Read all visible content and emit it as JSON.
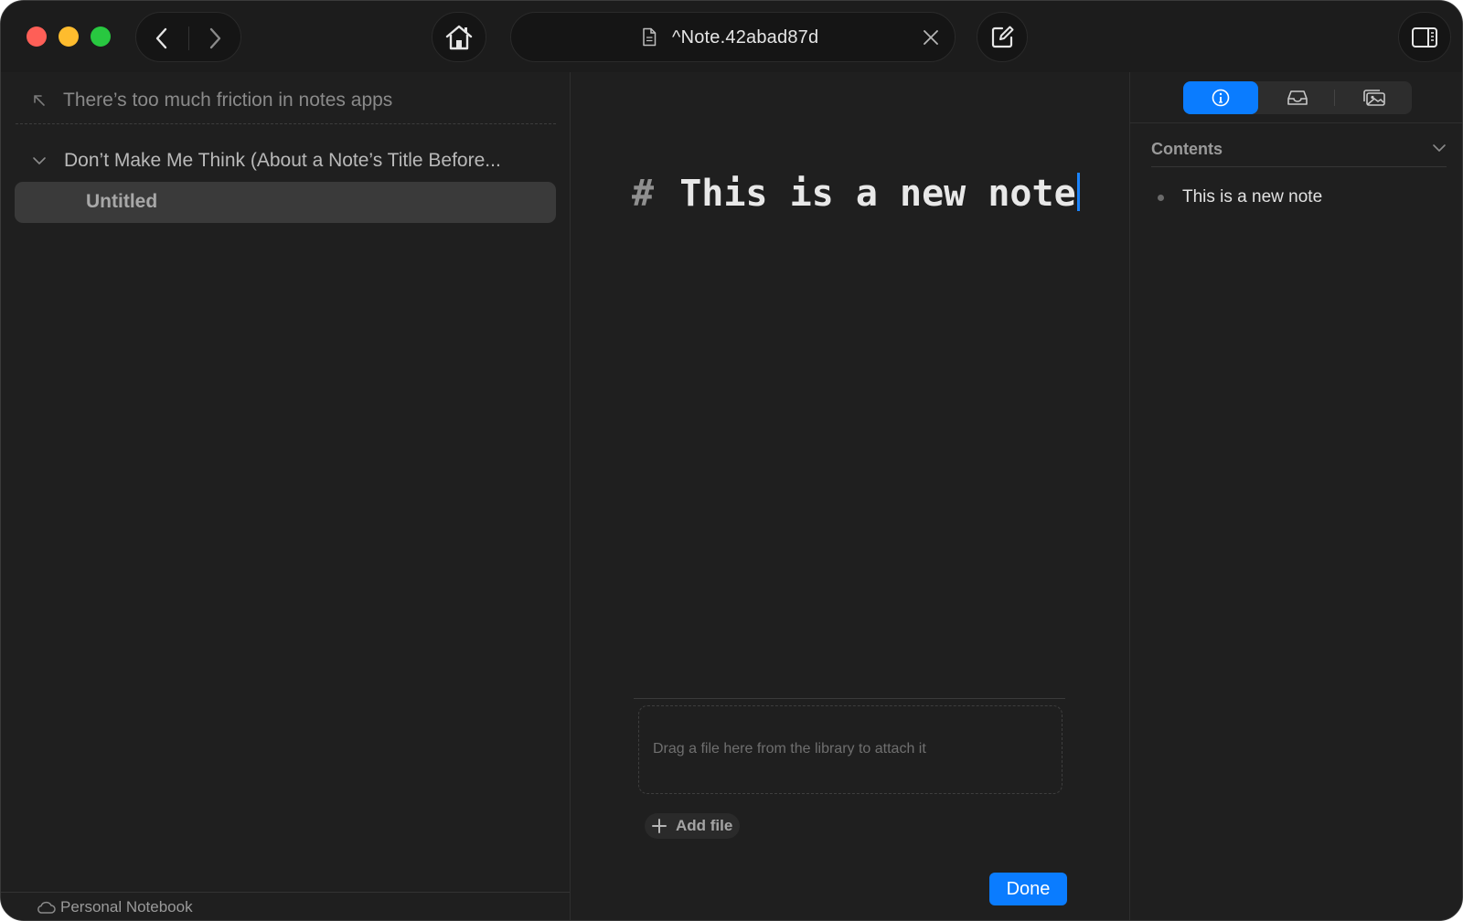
{
  "toolbar": {
    "address_text": "^Note.42abad87d"
  },
  "sidebar": {
    "parent_link": "There’s too much friction in notes apps",
    "tree_item": "Don’t Make Me Think (About a Note’s Title Before...",
    "selected_item": "Untitled",
    "footer_notebook": "Personal Notebook"
  },
  "editor": {
    "heading_marker": "#",
    "heading_text": "This is a new note",
    "dropzone_text": "Drag a file here from the library to attach it",
    "add_file_label": "Add file",
    "done_label": "Done"
  },
  "inspector": {
    "contents_label": "Contents",
    "toc": [
      "This is a new note"
    ]
  },
  "colors": {
    "accent": "#0a7cff",
    "traffic_red": "#fe5f57",
    "traffic_yellow": "#febc2e",
    "traffic_green": "#28c840"
  }
}
